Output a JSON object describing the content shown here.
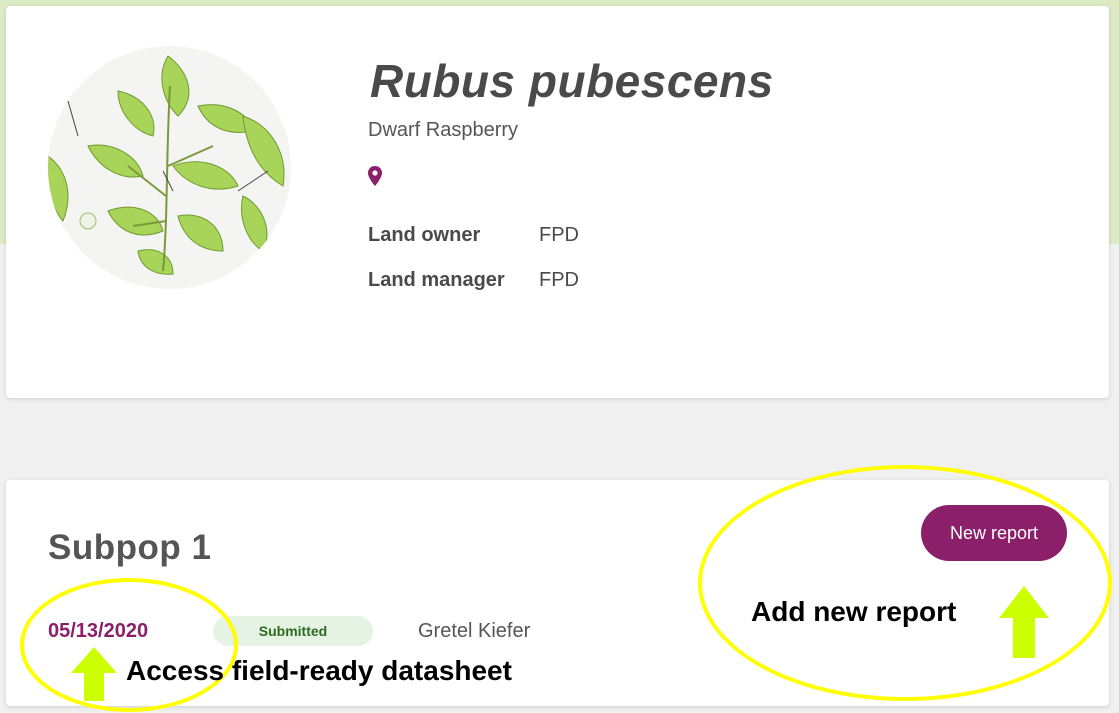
{
  "species": {
    "scientific_name": "Rubus pubescens",
    "common_name": "Dwarf Raspberry",
    "location_icon": "map-pin-icon",
    "land_owner_label": "Land owner",
    "land_owner_value": "FPD",
    "land_manager_label": "Land manager",
    "land_manager_value": "FPD"
  },
  "subpop": {
    "title": "Subpop 1",
    "new_report_label": "New report",
    "report": {
      "date": "05/13/2020",
      "status": "Submitted",
      "reporter": "Gretel Kiefer"
    }
  },
  "annotations": {
    "add_report": "Add new report",
    "datasheet": "Access field-ready datasheet"
  },
  "colors": {
    "brand": "#8b1f6a",
    "header_band": "#dcebc4",
    "status_bg": "#e4f3e4",
    "annotation": "#ffff00",
    "arrow": "#ccff00"
  }
}
